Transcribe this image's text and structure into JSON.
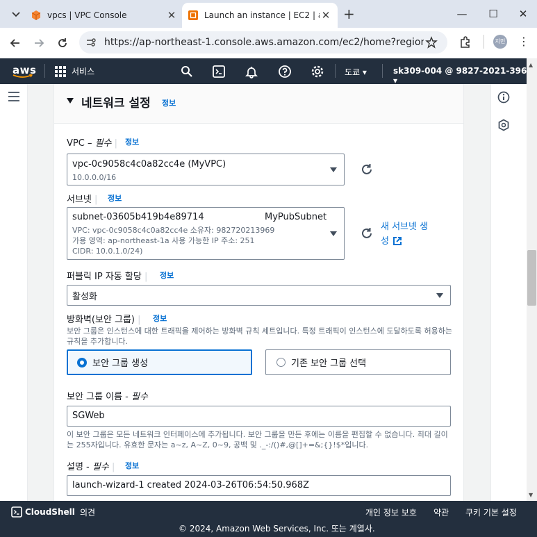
{
  "browser": {
    "tabs": [
      {
        "title": "vpcs | VPC Console"
      },
      {
        "title": "Launch an instance | EC2 | ap-"
      }
    ],
    "url": "https://ap-northeast-1.console.aws.amazon.com/ec2/home?region=ap-nor...",
    "profile": "지민"
  },
  "awsnav": {
    "logo": "aws",
    "services": "서비스",
    "region": "도쿄",
    "account": "sk309-004 @ 9827-2021-3969"
  },
  "section": {
    "title": "네트워크 설정",
    "info": "정보"
  },
  "vpc": {
    "label": "VPC –",
    "required": "필수",
    "info": "정보",
    "value": "vpc-0c9058c4c0a82cc4e (MyVPC)",
    "sub": "10.0.0.0/16"
  },
  "subnet": {
    "label": "서브넷",
    "info": "정보",
    "value": "subnet-03605b419b4e89714",
    "name": "MyPubSubnet",
    "line1": "VPC: vpc-0c9058c4c0a82cc4e     소유자: 982720213969",
    "line2": "가용 영역: ap-northeast-1a     사용 가능한 IP 주소: 251",
    "line3": "CIDR: 10.0.1.0/24)",
    "create_link_1": "새 서브넷 생",
    "create_link_2": "성"
  },
  "public_ip": {
    "label": "퍼블릭 IP 자동 할당",
    "info": "정보",
    "value": "활성화"
  },
  "firewall": {
    "label": "방화벽(보안 그룹)",
    "info": "정보",
    "desc": "보안 그룹은 인스턴스에 대한 트래픽을 제어하는 방화벽 규칙 세트입니다. 특정 트래픽이 인스턴스에 도달하도록 허용하는 규칙을 추가합니다.",
    "option_create": "보안 그룹 생성",
    "option_select": "기존 보안 그룹 선택"
  },
  "sg_name": {
    "label": "보안 그룹 이름 -",
    "required": "필수",
    "value": "SGWeb",
    "desc": "이 보안 그룹은 모든 네트워크 인터페이스에 추가됩니다. 보안 그룹을 만든 후에는 이름을 편집할 수 없습니다. 최대 길이는 255자입니다. 유효한 문자는 a~z, A~Z, 0~9, 공백 및 ._-:/()#,@[]+=&;{}!$*입니다."
  },
  "description": {
    "label": "설명 -",
    "required": "필수",
    "info": "정보",
    "value": "launch-wizard-1 created 2024-03-26T06:54:50.968Z"
  },
  "footer": {
    "cloudshell": "CloudShell",
    "feedback": "의견",
    "privacy": "개인 정보 보호",
    "terms": "약관",
    "cookies": "쿠키 기본 설정",
    "copyright": "© 2024, Amazon Web Services, Inc. 또는 계열사."
  },
  "colors": {
    "aws_nav": "#232f3e",
    "link": "#0972d3",
    "selected_bg": "#f2f8fd"
  }
}
